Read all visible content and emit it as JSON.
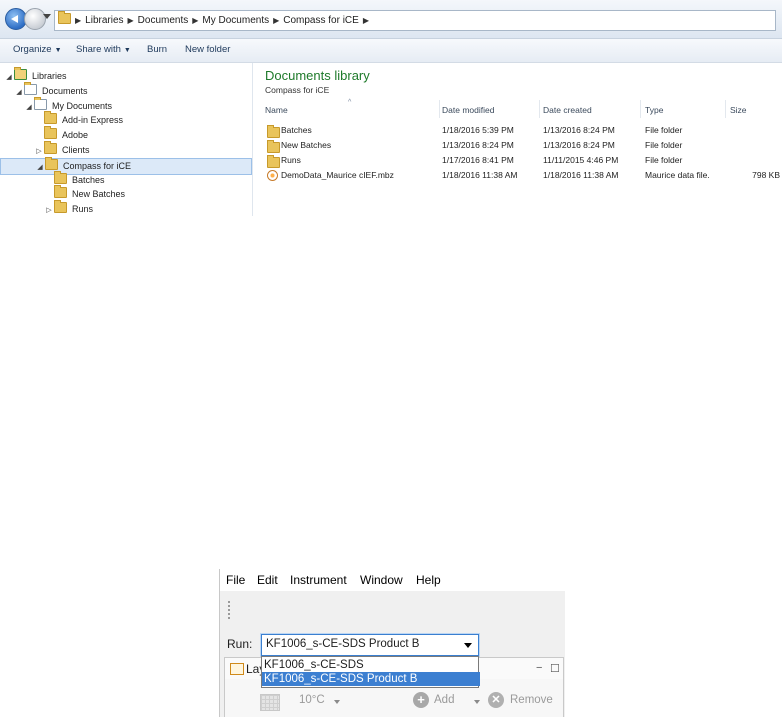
{
  "explorer": {
    "breadcrumb": [
      "Libraries",
      "Documents",
      "My Documents",
      "Compass for iCE"
    ],
    "toolbar": {
      "organize": "Organize",
      "share_with": "Share with",
      "burn": "Burn",
      "new_folder": "New folder"
    },
    "nav_tree": [
      {
        "label": "Libraries",
        "indent": 0,
        "icon": "libraries-icon",
        "expanded": true,
        "selected": false
      },
      {
        "label": "Documents",
        "indent": 1,
        "icon": "documents-icon",
        "expanded": true,
        "selected": false
      },
      {
        "label": "My Documents",
        "indent": 2,
        "icon": "documents-icon",
        "expanded": true,
        "selected": false
      },
      {
        "label": "Add-in Express",
        "indent": 3,
        "icon": "folder-icon",
        "expanded": null,
        "selected": false
      },
      {
        "label": "Adobe",
        "indent": 3,
        "icon": "folder-icon",
        "expanded": null,
        "selected": false
      },
      {
        "label": "Clients",
        "indent": 3,
        "icon": "folder-icon",
        "expanded": false,
        "selected": false
      },
      {
        "label": "Compass for iCE",
        "indent": 3,
        "icon": "folder-icon",
        "expanded": true,
        "selected": true
      },
      {
        "label": "Batches",
        "indent": 4,
        "icon": "folder-icon",
        "expanded": null,
        "selected": false
      },
      {
        "label": "New Batches",
        "indent": 4,
        "icon": "folder-icon",
        "expanded": null,
        "selected": false
      },
      {
        "label": "Runs",
        "indent": 4,
        "icon": "folder-icon",
        "expanded": false,
        "selected": false
      }
    ],
    "library_title": "Documents library",
    "library_subtitle": "Compass for iCE",
    "columns": {
      "name": "Name",
      "date_modified": "Date modified",
      "date_created": "Date created",
      "type": "Type",
      "size": "Size"
    },
    "files": [
      {
        "name": "Batches",
        "date_modified": "1/18/2016 5:39 PM",
        "date_created": "1/13/2016 8:24 PM",
        "type": "File folder",
        "size": "",
        "icon": "folder-icon"
      },
      {
        "name": "New Batches",
        "date_modified": "1/13/2016 8:24 PM",
        "date_created": "1/13/2016 8:24 PM",
        "type": "File folder",
        "size": "",
        "icon": "folder-icon"
      },
      {
        "name": "Runs",
        "date_modified": "1/17/2016 8:41 PM",
        "date_created": "11/11/2015 4:46 PM",
        "type": "File folder",
        "size": "",
        "icon": "folder-icon"
      },
      {
        "name": "DemoData_Maurice cIEF.mbz",
        "date_modified": "1/18/2016 11:38 AM",
        "date_created": "1/18/2016 11:38 AM",
        "type": "Maurice data file.",
        "size": "798 KB",
        "icon": "mbz-file-icon"
      }
    ]
  },
  "app": {
    "menu": [
      "File",
      "Edit",
      "Instrument",
      "Window",
      "Help"
    ],
    "run_label": "Run:",
    "run_selected": "KF1006_s-CE-SDS Product B",
    "run_options": [
      "KF1006_s-CE-SDS",
      "KF1006_s-CE-SDS Product B"
    ],
    "highlighted_option": 1,
    "panel_tab": "Lay",
    "temperature": "10°C",
    "add_label": "Add",
    "remove_label": "Remove"
  },
  "colors": {
    "library_title": "#1e7a2a",
    "selection": "#dce9f8",
    "dropdown_highlight": "#3c7fd1"
  }
}
